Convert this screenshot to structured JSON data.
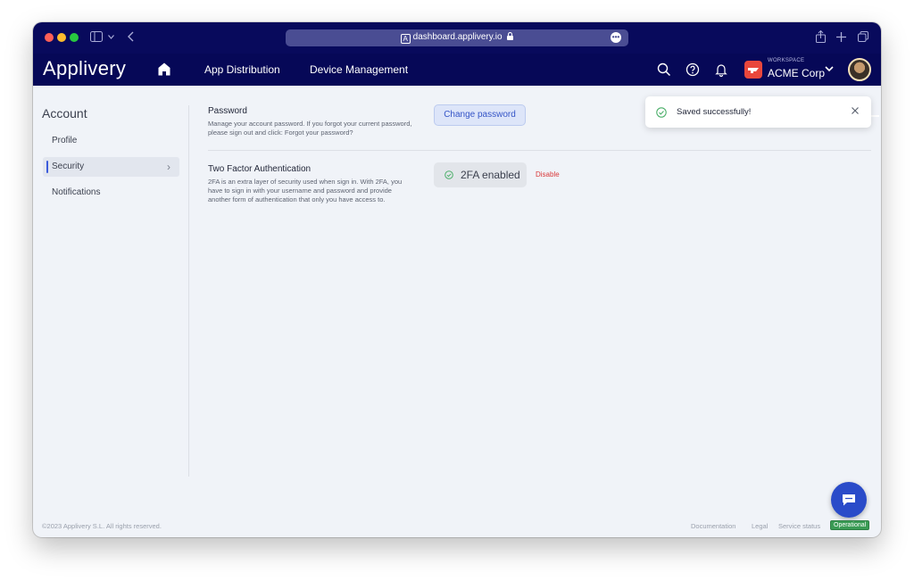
{
  "browser": {
    "url": "dashboard.applivery.io",
    "traffic_colors": [
      "#ff5f57",
      "#febc2e",
      "#28c840"
    ],
    "icons": [
      "sidebar-toggle-icon",
      "chevron-down-icon",
      "back-icon",
      "site-icon",
      "lock-icon",
      "more-icon",
      "share-icon",
      "new-tab-icon",
      "tabs-icon"
    ]
  },
  "nav": {
    "logo": "Applivery",
    "links": [
      "App Distribution",
      "Device Management"
    ],
    "workspace_label": "WORKSPACE",
    "workspace_name": "ACME Corp"
  },
  "sidebar": {
    "title": "Account",
    "items": [
      {
        "label": "Profile"
      },
      {
        "label": "Security",
        "active": true
      },
      {
        "label": "Notifications"
      }
    ]
  },
  "password": {
    "title": "Password",
    "description": "Manage your account password. If you forgot your current password, please sign out and click: Forgot your password?",
    "button": "Change password"
  },
  "twofa": {
    "title": "Two Factor Authentication",
    "description": "2FA is an extra layer of security used when sign in. With 2FA, you have to sign in with your username and password and provide another form of authentication that only you have access to.",
    "status": "2FA enabled",
    "disable": "Disable"
  },
  "toast": {
    "message": "Saved successfully!"
  },
  "footer": {
    "copyright": "©2023 Applivery S.L. All rights reserved.",
    "links": [
      "Documentation",
      "Legal",
      "Service status"
    ],
    "status": "Operational"
  },
  "colors": {
    "nav_bg": "#060857",
    "accent": "#3555c7",
    "success": "#3a9b55",
    "danger": "#d93a3a"
  }
}
